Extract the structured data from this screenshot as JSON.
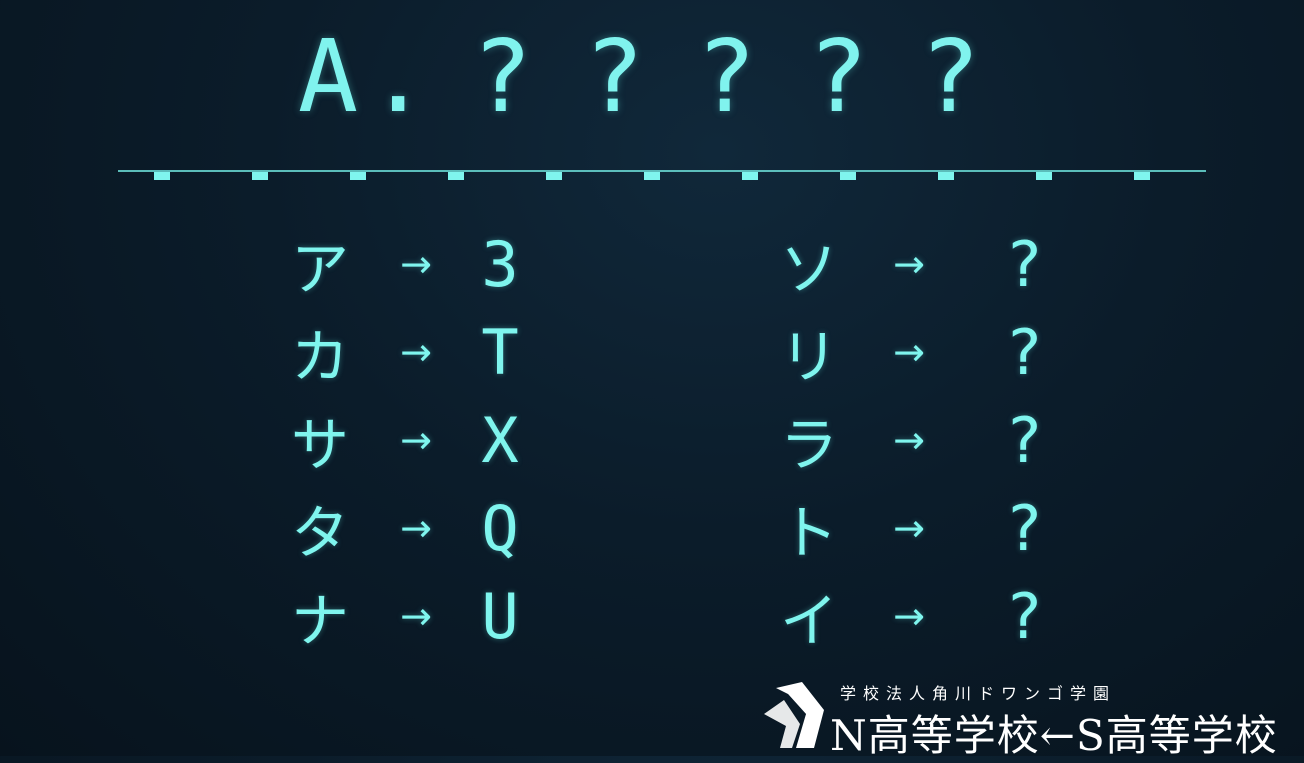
{
  "title": {
    "prefix": "A",
    "dot": ".",
    "blanks": [
      "?",
      "?",
      "?",
      "?",
      "?"
    ]
  },
  "ticks_count": 11,
  "left_mapping": [
    {
      "from": "ア",
      "arrow": "→",
      "to": "3"
    },
    {
      "from": "カ",
      "arrow": "→",
      "to": "T"
    },
    {
      "from": "サ",
      "arrow": "→",
      "to": "X"
    },
    {
      "from": "タ",
      "arrow": "→",
      "to": "Q"
    },
    {
      "from": "ナ",
      "arrow": "→",
      "to": "U"
    }
  ],
  "right_mapping": [
    {
      "from": "ソ",
      "arrow": "→",
      "to": "?"
    },
    {
      "from": "リ",
      "arrow": "→",
      "to": "?"
    },
    {
      "from": "ラ",
      "arrow": "→",
      "to": "?"
    },
    {
      "from": "ト",
      "arrow": "→",
      "to": "?"
    },
    {
      "from": "イ",
      "arrow": "→",
      "to": "?"
    }
  ],
  "branding": {
    "subtitle": "学校法人角川ドワンゴ学園",
    "name": "N高等学校←S高等学校"
  },
  "colors": {
    "accent": "#7ff5ee",
    "background": "#0b1c2a",
    "brand_text": "#ffffff"
  }
}
